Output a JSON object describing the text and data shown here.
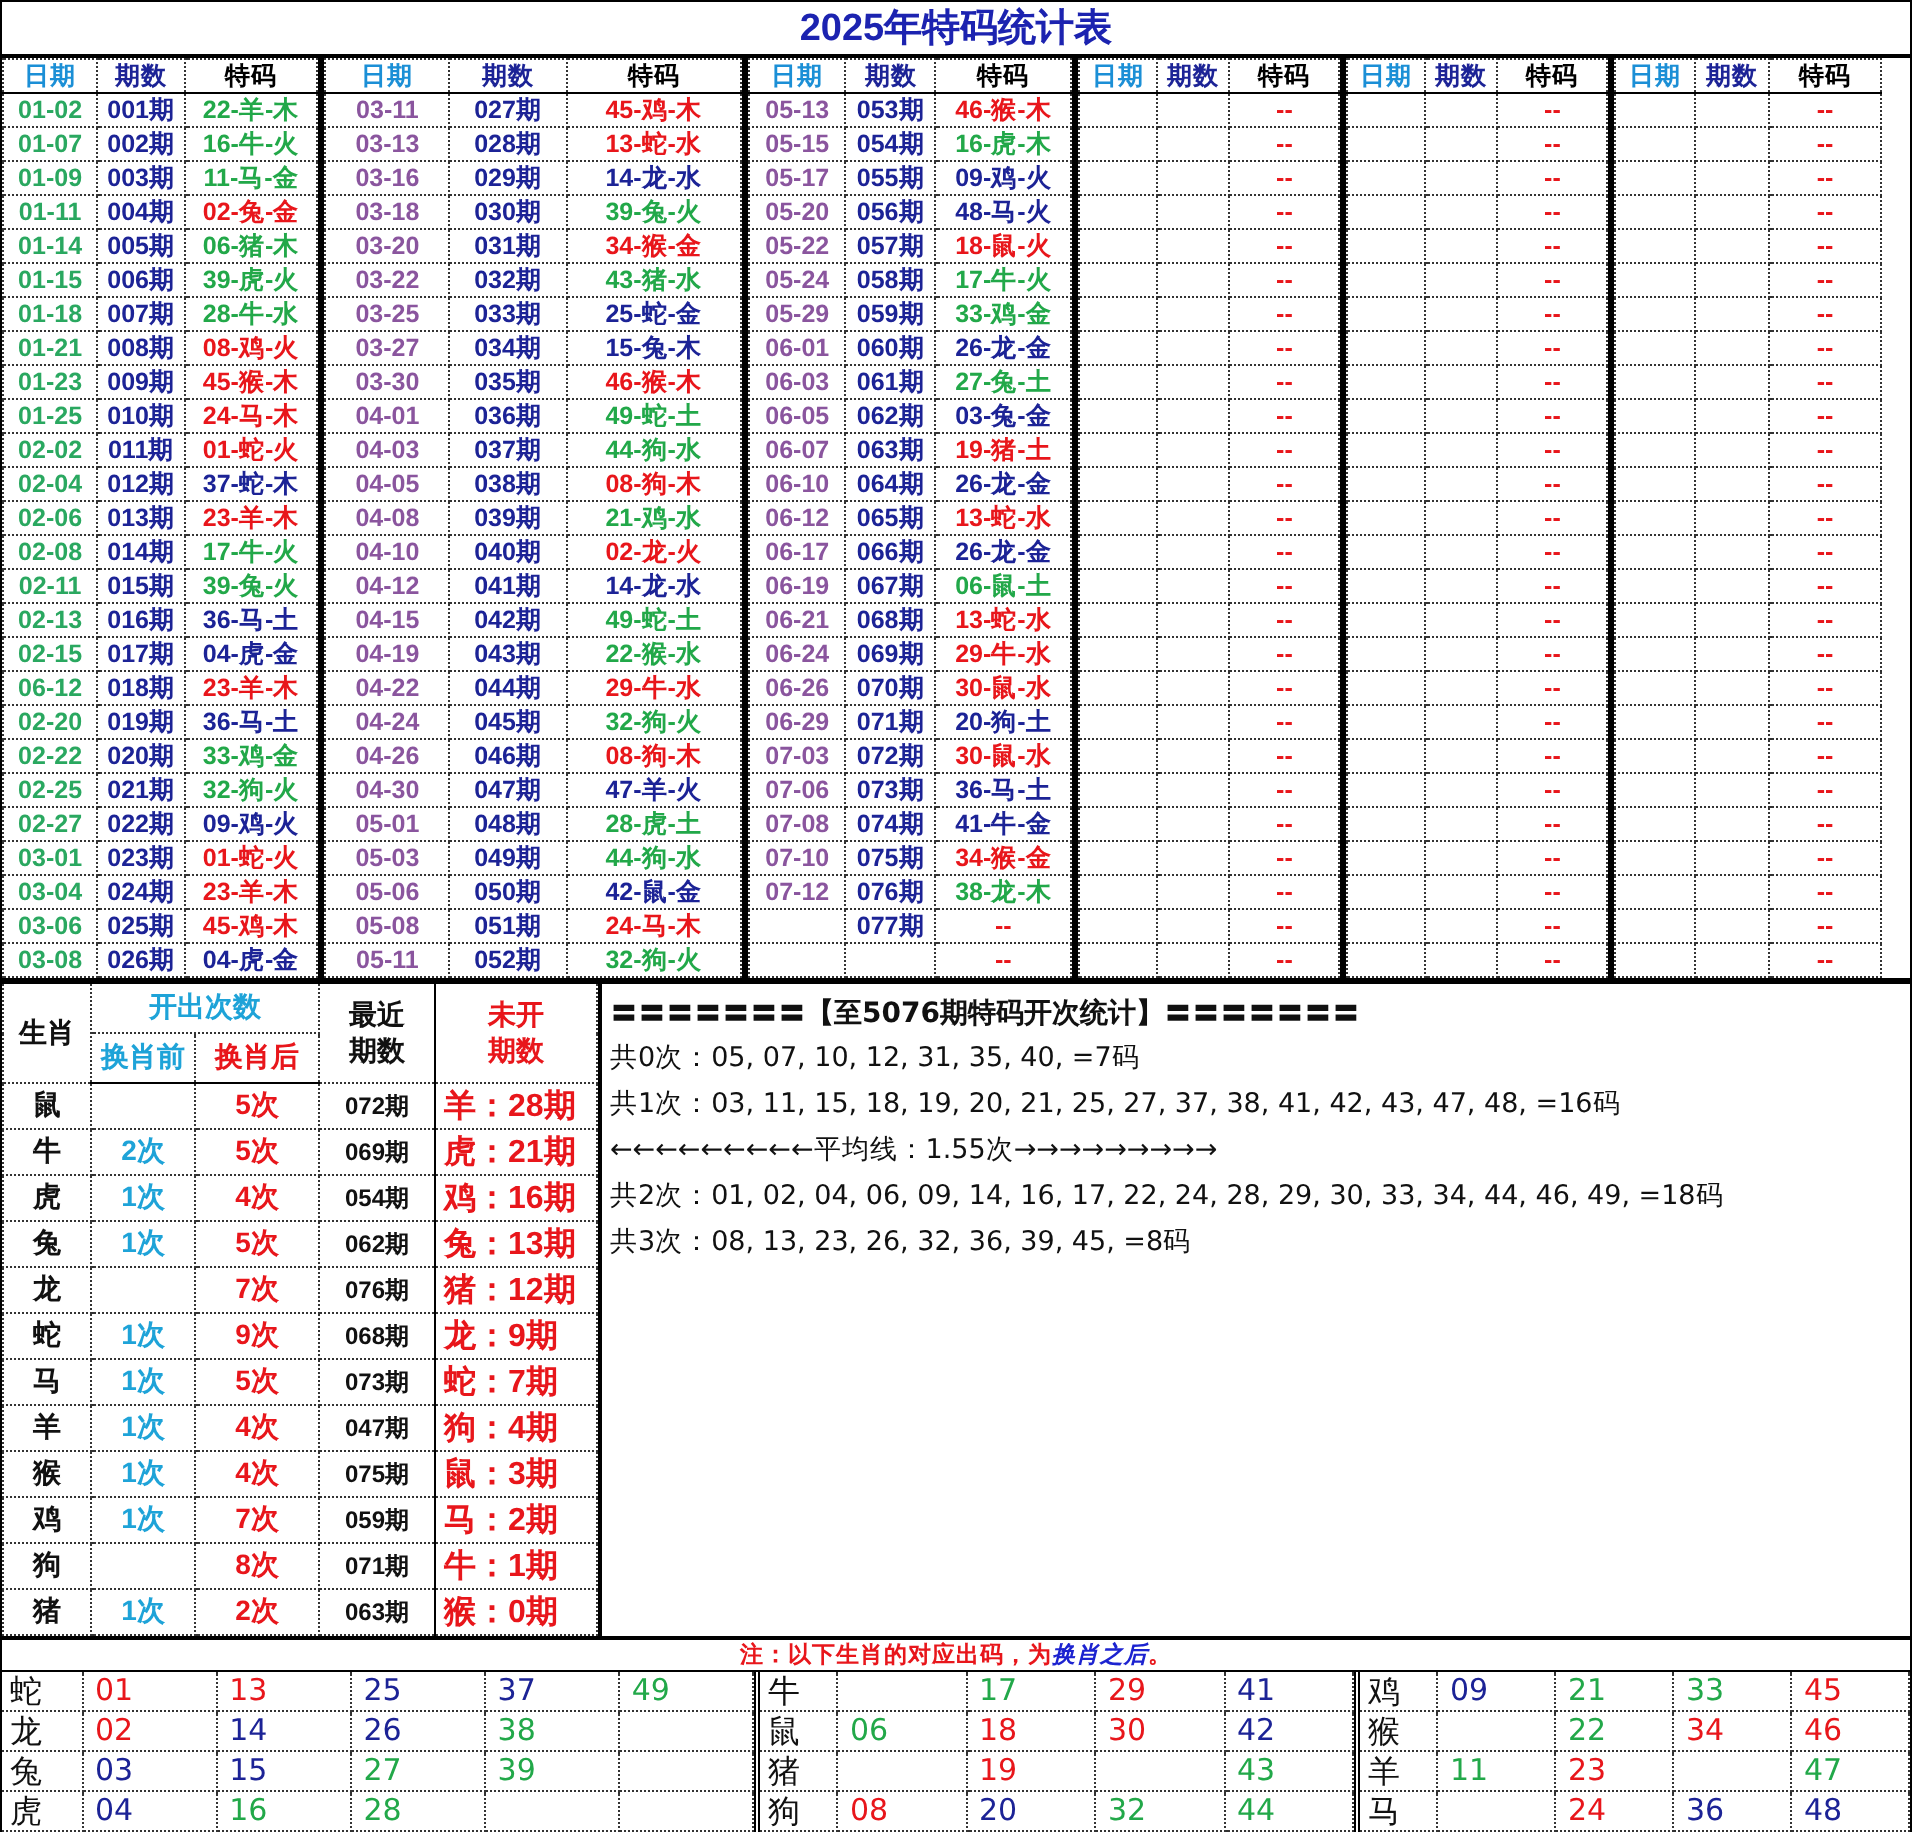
{
  "title": "2025年特码统计表",
  "main": {
    "groups": [
      {
        "headers": [
          "日期",
          "期数",
          "特码"
        ],
        "rows": [
          {
            "date": "01-02",
            "period": "001期",
            "code": "22-羊-木",
            "color": "#22a849"
          },
          {
            "date": "01-07",
            "period": "002期",
            "code": "16-牛-火",
            "color": "#22a849"
          },
          {
            "date": "01-09",
            "period": "003期",
            "code": "11-马-金",
            "color": "#22a849"
          },
          {
            "date": "01-11",
            "period": "004期",
            "code": "02-兔-金",
            "color": "#e8161b"
          },
          {
            "date": "01-14",
            "period": "005期",
            "code": "06-猪-木",
            "color": "#22a849"
          },
          {
            "date": "01-15",
            "period": "006期",
            "code": "39-虎-火",
            "color": "#22a849"
          },
          {
            "date": "01-18",
            "period": "007期",
            "code": "28-牛-水",
            "color": "#22a849"
          },
          {
            "date": "01-21",
            "period": "008期",
            "code": "08-鸡-火",
            "color": "#e8161b"
          },
          {
            "date": "01-23",
            "period": "009期",
            "code": "45-猴-木",
            "color": "#e8161b"
          },
          {
            "date": "01-25",
            "period": "010期",
            "code": "24-马-木",
            "color": "#e8161b"
          },
          {
            "date": "02-02",
            "period": "011期",
            "code": "01-蛇-火",
            "color": "#e8161b"
          },
          {
            "date": "02-04",
            "period": "012期",
            "code": "37-蛇-木",
            "color": "#1c2396"
          },
          {
            "date": "02-06",
            "period": "013期",
            "code": "23-羊-木",
            "color": "#e8161b"
          },
          {
            "date": "02-08",
            "period": "014期",
            "code": "17-牛-火",
            "color": "#22a849"
          },
          {
            "date": "02-11",
            "period": "015期",
            "code": "39-兔-火",
            "color": "#22a849"
          },
          {
            "date": "02-13",
            "period": "016期",
            "code": "36-马-土",
            "color": "#1c2396"
          },
          {
            "date": "02-15",
            "period": "017期",
            "code": "04-虎-金",
            "color": "#1c2396"
          },
          {
            "date": "06-12",
            "period": "018期",
            "code": "23-羊-木",
            "color": "#e8161b"
          },
          {
            "date": "02-20",
            "period": "019期",
            "code": "36-马-土",
            "color": "#1c2396"
          },
          {
            "date": "02-22",
            "period": "020期",
            "code": "33-鸡-金",
            "color": "#22a849"
          },
          {
            "date": "02-25",
            "period": "021期",
            "code": "32-狗-火",
            "color": "#22a849"
          },
          {
            "date": "02-27",
            "period": "022期",
            "code": "09-鸡-火",
            "color": "#1c2396"
          },
          {
            "date": "03-01",
            "period": "023期",
            "code": "01-蛇-火",
            "color": "#e8161b"
          },
          {
            "date": "03-04",
            "period": "024期",
            "code": "23-羊-木",
            "color": "#e8161b"
          },
          {
            "date": "03-06",
            "period": "025期",
            "code": "45-鸡-木",
            "color": "#e8161b"
          },
          {
            "date": "03-08",
            "period": "026期",
            "code": "04-虎-金",
            "color": "#1c2396"
          }
        ]
      },
      {
        "headers": [
          "日期",
          "期数",
          "特码"
        ],
        "rows": [
          {
            "date": "03-11",
            "period": "027期",
            "code": "45-鸡-木",
            "color": "#e8161b"
          },
          {
            "date": "03-13",
            "period": "028期",
            "code": "13-蛇-水",
            "color": "#e8161b"
          },
          {
            "date": "03-16",
            "period": "029期",
            "code": "14-龙-水",
            "color": "#1c2396"
          },
          {
            "date": "03-18",
            "period": "030期",
            "code": "39-兔-火",
            "color": "#22a849"
          },
          {
            "date": "03-20",
            "period": "031期",
            "code": "34-猴-金",
            "color": "#e8161b"
          },
          {
            "date": "03-22",
            "period": "032期",
            "code": "43-猪-水",
            "color": "#22a849"
          },
          {
            "date": "03-25",
            "period": "033期",
            "code": "25-蛇-金",
            "color": "#1c2396"
          },
          {
            "date": "03-27",
            "period": "034期",
            "code": "15-兔-木",
            "color": "#1c2396"
          },
          {
            "date": "03-30",
            "period": "035期",
            "code": "46-猴-木",
            "color": "#e8161b"
          },
          {
            "date": "04-01",
            "period": "036期",
            "code": "49-蛇-土",
            "color": "#22a849"
          },
          {
            "date": "04-03",
            "period": "037期",
            "code": "44-狗-水",
            "color": "#22a849"
          },
          {
            "date": "04-05",
            "period": "038期",
            "code": "08-狗-木",
            "color": "#e8161b"
          },
          {
            "date": "04-08",
            "period": "039期",
            "code": "21-鸡-水",
            "color": "#22a849"
          },
          {
            "date": "04-10",
            "period": "040期",
            "code": "02-龙-火",
            "color": "#e8161b"
          },
          {
            "date": "04-12",
            "period": "041期",
            "code": "14-龙-水",
            "color": "#1c2396"
          },
          {
            "date": "04-15",
            "period": "042期",
            "code": "49-蛇-土",
            "color": "#22a849"
          },
          {
            "date": "04-19",
            "period": "043期",
            "code": "22-猴-水",
            "color": "#22a849"
          },
          {
            "date": "04-22",
            "period": "044期",
            "code": "29-牛-水",
            "color": "#e8161b"
          },
          {
            "date": "04-24",
            "period": "045期",
            "code": "32-狗-火",
            "color": "#22a849"
          },
          {
            "date": "04-26",
            "period": "046期",
            "code": "08-狗-木",
            "color": "#e8161b"
          },
          {
            "date": "04-30",
            "period": "047期",
            "code": "47-羊-火",
            "color": "#1c2396"
          },
          {
            "date": "05-01",
            "period": "048期",
            "code": "28-虎-土",
            "color": "#22a849"
          },
          {
            "date": "05-03",
            "period": "049期",
            "code": "44-狗-水",
            "color": "#22a849"
          },
          {
            "date": "05-06",
            "period": "050期",
            "code": "42-鼠-金",
            "color": "#1c2396"
          },
          {
            "date": "05-08",
            "period": "051期",
            "code": "24-马-木",
            "color": "#e8161b"
          },
          {
            "date": "05-11",
            "period": "052期",
            "code": "32-狗-火",
            "color": "#22a849"
          }
        ]
      },
      {
        "headers": [
          "日期",
          "期数",
          "特码"
        ],
        "rows": [
          {
            "date": "05-13",
            "period": "053期",
            "code": "46-猴-木",
            "color": "#e8161b"
          },
          {
            "date": "05-15",
            "period": "054期",
            "code": "16-虎-木",
            "color": "#22a849"
          },
          {
            "date": "05-17",
            "period": "055期",
            "code": "09-鸡-火",
            "color": "#1c2396"
          },
          {
            "date": "05-20",
            "period": "056期",
            "code": "48-马-火",
            "color": "#1c2396"
          },
          {
            "date": "05-22",
            "period": "057期",
            "code": "18-鼠-火",
            "color": "#e8161b"
          },
          {
            "date": "05-24",
            "period": "058期",
            "code": "17-牛-火",
            "color": "#22a849"
          },
          {
            "date": "05-29",
            "period": "059期",
            "code": "33-鸡-金",
            "color": "#22a849"
          },
          {
            "date": "06-01",
            "period": "060期",
            "code": "26-龙-金",
            "color": "#1c2396"
          },
          {
            "date": "06-03",
            "period": "061期",
            "code": "27-兔-土",
            "color": "#22a849"
          },
          {
            "date": "06-05",
            "period": "062期",
            "code": "03-兔-金",
            "color": "#1c2396"
          },
          {
            "date": "06-07",
            "period": "063期",
            "code": "19-猪-土",
            "color": "#e8161b"
          },
          {
            "date": "06-10",
            "period": "064期",
            "code": "26-龙-金",
            "color": "#1c2396"
          },
          {
            "date": "06-12",
            "period": "065期",
            "code": "13-蛇-水",
            "color": "#e8161b"
          },
          {
            "date": "06-17",
            "period": "066期",
            "code": "26-龙-金",
            "color": "#1c2396"
          },
          {
            "date": "06-19",
            "period": "067期",
            "code": "06-鼠-土",
            "color": "#22a849"
          },
          {
            "date": "06-21",
            "period": "068期",
            "code": "13-蛇-水",
            "color": "#e8161b"
          },
          {
            "date": "06-24",
            "period": "069期",
            "code": "29-牛-水",
            "color": "#e8161b"
          },
          {
            "date": "06-26",
            "period": "070期",
            "code": "30-鼠-水",
            "color": "#e8161b"
          },
          {
            "date": "06-29",
            "period": "071期",
            "code": "20-狗-土",
            "color": "#1c2396"
          },
          {
            "date": "07-03",
            "period": "072期",
            "code": "30-鼠-水",
            "color": "#e8161b"
          },
          {
            "date": "07-06",
            "period": "073期",
            "code": "36-马-土",
            "color": "#1c2396"
          },
          {
            "date": "07-08",
            "period": "074期",
            "code": "41-牛-金",
            "color": "#1c2396"
          },
          {
            "date": "07-10",
            "period": "075期",
            "code": "34-猴-金",
            "color": "#e8161b"
          },
          {
            "date": "07-12",
            "period": "076期",
            "code": "38-龙-木",
            "color": "#22a849"
          },
          {
            "period": "077期",
            "code": "--",
            "color": "#e8161b"
          },
          {
            "code": "--",
            "color": "#e8161b"
          }
        ]
      },
      {
        "headers": [
          "日期",
          "期数",
          "特码"
        ],
        "rows": [
          {
            "code": "--",
            "color": "#e8161b"
          },
          {
            "code": "--",
            "color": "#e8161b"
          },
          {
            "code": "--",
            "color": "#e8161b"
          },
          {
            "code": "--",
            "color": "#e8161b"
          },
          {
            "code": "--",
            "color": "#e8161b"
          },
          {
            "code": "--",
            "color": "#e8161b"
          },
          {
            "code": "--",
            "color": "#e8161b"
          },
          {
            "code": "--",
            "color": "#e8161b"
          },
          {
            "code": "--",
            "color": "#e8161b"
          },
          {
            "code": "--",
            "color": "#e8161b"
          },
          {
            "code": "--",
            "color": "#e8161b"
          },
          {
            "code": "--",
            "color": "#e8161b"
          },
          {
            "code": "--",
            "color": "#e8161b"
          },
          {
            "code": "--",
            "color": "#e8161b"
          },
          {
            "code": "--",
            "color": "#e8161b"
          },
          {
            "code": "--",
            "color": "#e8161b"
          },
          {
            "code": "--",
            "color": "#e8161b"
          },
          {
            "code": "--",
            "color": "#e8161b"
          },
          {
            "code": "--",
            "color": "#e8161b"
          },
          {
            "code": "--",
            "color": "#e8161b"
          },
          {
            "code": "--",
            "color": "#e8161b"
          },
          {
            "code": "--",
            "color": "#e8161b"
          },
          {
            "code": "--",
            "color": "#e8161b"
          },
          {
            "code": "--",
            "color": "#e8161b"
          },
          {
            "code": "--",
            "color": "#e8161b"
          },
          {
            "code": "--",
            "color": "#e8161b"
          }
        ]
      },
      {
        "headers": [
          "日期",
          "期数",
          "特码"
        ],
        "rows": [
          {
            "code": "--",
            "color": "#e8161b"
          },
          {
            "code": "--",
            "color": "#e8161b"
          },
          {
            "code": "--",
            "color": "#e8161b"
          },
          {
            "code": "--",
            "color": "#e8161b"
          },
          {
            "code": "--",
            "color": "#e8161b"
          },
          {
            "code": "--",
            "color": "#e8161b"
          },
          {
            "code": "--",
            "color": "#e8161b"
          },
          {
            "code": "--",
            "color": "#e8161b"
          },
          {
            "code": "--",
            "color": "#e8161b"
          },
          {
            "code": "--",
            "color": "#e8161b"
          },
          {
            "code": "--",
            "color": "#e8161b"
          },
          {
            "code": "--",
            "color": "#e8161b"
          },
          {
            "code": "--",
            "color": "#e8161b"
          },
          {
            "code": "--",
            "color": "#e8161b"
          },
          {
            "code": "--",
            "color": "#e8161b"
          },
          {
            "code": "--",
            "color": "#e8161b"
          },
          {
            "code": "--",
            "color": "#e8161b"
          },
          {
            "code": "--",
            "color": "#e8161b"
          },
          {
            "code": "--",
            "color": "#e8161b"
          },
          {
            "code": "--",
            "color": "#e8161b"
          },
          {
            "code": "--",
            "color": "#e8161b"
          },
          {
            "code": "--",
            "color": "#e8161b"
          },
          {
            "code": "--",
            "color": "#e8161b"
          },
          {
            "code": "--",
            "color": "#e8161b"
          },
          {
            "code": "--",
            "color": "#e8161b"
          },
          {
            "code": "--",
            "color": "#e8161b"
          }
        ]
      },
      {
        "headers": [
          "日期",
          "期数",
          "特码"
        ],
        "rows": [
          {
            "code": "--",
            "color": "#e8161b"
          },
          {
            "code": "--",
            "color": "#e8161b"
          },
          {
            "code": "--",
            "color": "#e8161b"
          },
          {
            "code": "--",
            "color": "#e8161b"
          },
          {
            "code": "--",
            "color": "#e8161b"
          },
          {
            "code": "--",
            "color": "#e8161b"
          },
          {
            "code": "--",
            "color": "#e8161b"
          },
          {
            "code": "--",
            "color": "#e8161b"
          },
          {
            "code": "--",
            "color": "#e8161b"
          },
          {
            "code": "--",
            "color": "#e8161b"
          },
          {
            "code": "--",
            "color": "#e8161b"
          },
          {
            "code": "--",
            "color": "#e8161b"
          },
          {
            "code": "--",
            "color": "#e8161b"
          },
          {
            "code": "--",
            "color": "#e8161b"
          },
          {
            "code": "--",
            "color": "#e8161b"
          },
          {
            "code": "--",
            "color": "#e8161b"
          },
          {
            "code": "--",
            "color": "#e8161b"
          },
          {
            "code": "--",
            "color": "#e8161b"
          },
          {
            "code": "--",
            "color": "#e8161b"
          },
          {
            "code": "--",
            "color": "#e8161b"
          },
          {
            "code": "--",
            "color": "#e8161b"
          },
          {
            "code": "--",
            "color": "#e8161b"
          },
          {
            "code": "--",
            "color": "#e8161b"
          },
          {
            "code": "--",
            "color": "#e8161b"
          },
          {
            "code": "--",
            "color": "#e8161b"
          },
          {
            "code": "--",
            "color": "#e8161b"
          }
        ]
      }
    ]
  },
  "zodiac_stats": {
    "headers": {
      "zodiac": "生肖",
      "count": "开出次数",
      "before": "换肖前",
      "after": "换肖后",
      "recent": [
        "最近",
        "期数"
      ],
      "missing": [
        "未开",
        "期数"
      ]
    },
    "rows": [
      {
        "zodiac": "鼠",
        "after": "5次",
        "recent": "072期",
        "missing": "羊：28期"
      },
      {
        "zodiac": "牛",
        "before": "2次",
        "after": "5次",
        "recent": "069期",
        "missing": "虎：21期"
      },
      {
        "zodiac": "虎",
        "before": "1次",
        "after": "4次",
        "recent": "054期",
        "missing": "鸡：16期"
      },
      {
        "zodiac": "兔",
        "before": "1次",
        "after": "5次",
        "recent": "062期",
        "missing": "兔：13期"
      },
      {
        "zodiac": "龙",
        "after": "7次",
        "recent": "076期",
        "missing": "猪：12期"
      },
      {
        "zodiac": "蛇",
        "before": "1次",
        "after": "9次",
        "recent": "068期",
        "missing": "龙：9期"
      },
      {
        "zodiac": "马",
        "before": "1次",
        "after": "5次",
        "recent": "073期",
        "missing": "蛇：7期"
      },
      {
        "zodiac": "羊",
        "before": "1次",
        "after": "4次",
        "recent": "047期",
        "missing": "狗：4期"
      },
      {
        "zodiac": "猴",
        "before": "1次",
        "after": "4次",
        "recent": "075期",
        "missing": "鼠：3期"
      },
      {
        "zodiac": "鸡",
        "before": "1次",
        "after": "7次",
        "recent": "059期",
        "missing": "马：2期"
      },
      {
        "zodiac": "狗",
        "after": "8次",
        "recent": "071期",
        "missing": "牛：1期"
      },
      {
        "zodiac": "猪",
        "before": "1次",
        "after": "2次",
        "recent": "063期",
        "missing": "猴：0期"
      }
    ]
  },
  "summary": {
    "heading": "〓〓〓〓〓〓〓【至5076期特码开次统计】〓〓〓〓〓〓〓",
    "lines": [
      "共0次：05, 07, 10, 12, 31, 35, 40, =7码",
      "共1次：03, 11, 15, 18, 19, 20, 21, 25, 27, 37, 38, 41, 42, 43, 47, 48, =16码",
      "←←←←←←←←←平均线：1.55次→→→→→→→→→",
      "共2次：01, 02, 04, 06, 09, 14, 16, 17, 22, 24, 28, 29, 30, 33, 34, 44, 46, 49, =18码",
      "共3次：08, 13, 23, 26, 32, 36, 39, 45, =8码"
    ]
  },
  "note": {
    "lead": "注：以下生肖的对应出码，为",
    "highlight": "换肖之后",
    "end": "。"
  },
  "number_grid": {
    "blocks": [
      {
        "rows": [
          {
            "zodiac": "蛇",
            "n1": {
              "text": "01",
              "color": "#e8161b"
            },
            "n2": {
              "text": "13",
              "color": "#e8161b"
            },
            "n3": {
              "text": "25",
              "color": "#1c2396"
            },
            "n4": {
              "text": "37",
              "color": "#1c2396"
            },
            "n5": {
              "text": "49",
              "color": "#22a849"
            }
          },
          {
            "zodiac": "龙",
            "n1": {
              "text": "02",
              "color": "#e8161b"
            },
            "n2": {
              "text": "14",
              "color": "#1c2396"
            },
            "n3": {
              "text": "26",
              "color": "#1c2396"
            },
            "n4": {
              "text": "38",
              "color": "#22a849"
            }
          },
          {
            "zodiac": "兔",
            "n1": {
              "text": "03",
              "color": "#1c2396"
            },
            "n2": {
              "text": "15",
              "color": "#1c2396"
            },
            "n3": {
              "text": "27",
              "color": "#22a849"
            },
            "n4": {
              "text": "39",
              "color": "#22a849"
            }
          },
          {
            "zodiac": "虎",
            "n1": {
              "text": "04",
              "color": "#1c2396"
            },
            "n2": {
              "text": "16",
              "color": "#22a849"
            },
            "n3": {
              "text": "28",
              "color": "#22a849"
            }
          }
        ]
      },
      {
        "rows": [
          {
            "zodiac": "牛",
            "n2": {
              "text": "17",
              "color": "#22a849"
            },
            "n3": {
              "text": "29",
              "color": "#e8161b"
            },
            "n4": {
              "text": "41",
              "color": "#1c2396"
            }
          },
          {
            "zodiac": "鼠",
            "n1": {
              "text": "06",
              "color": "#22a849"
            },
            "n2": {
              "text": "18",
              "color": "#e8161b"
            },
            "n3": {
              "text": "30",
              "color": "#e8161b"
            },
            "n4": {
              "text": "42",
              "color": "#1c2396"
            }
          },
          {
            "zodiac": "猪",
            "n2": {
              "text": "19",
              "color": "#e8161b"
            },
            "n4": {
              "text": "43",
              "color": "#22a849"
            }
          },
          {
            "zodiac": "狗",
            "n1": {
              "text": "08",
              "color": "#e8161b"
            },
            "n2": {
              "text": "20",
              "color": "#1c2396"
            },
            "n3": {
              "text": "32",
              "color": "#22a849"
            },
            "n4": {
              "text": "44",
              "color": "#22a849"
            }
          }
        ]
      },
      {
        "rows": [
          {
            "zodiac": "鸡",
            "n1": {
              "text": "09",
              "color": "#1c2396"
            },
            "n2": {
              "text": "21",
              "color": "#22a849"
            },
            "n3": {
              "text": "33",
              "color": "#22a849"
            },
            "n4": {
              "text": "45",
              "color": "#e8161b"
            }
          },
          {
            "zodiac": "猴",
            "n2": {
              "text": "22",
              "color": "#22a849"
            },
            "n3": {
              "text": "34",
              "color": "#e8161b"
            },
            "n4": {
              "text": "46",
              "color": "#e8161b"
            }
          },
          {
            "zodiac": "羊",
            "n1": {
              "text": "11",
              "color": "#22a849"
            },
            "n2": {
              "text": "23",
              "color": "#e8161b"
            },
            "n4": {
              "text": "47",
              "color": "#22a849"
            }
          },
          {
            "zodiac": "马",
            "n2": {
              "text": "24",
              "color": "#e8161b"
            },
            "n3": {
              "text": "36",
              "color": "#1c2396"
            },
            "n4": {
              "text": "48",
              "color": "#1c2396"
            }
          }
        ]
      }
    ]
  }
}
